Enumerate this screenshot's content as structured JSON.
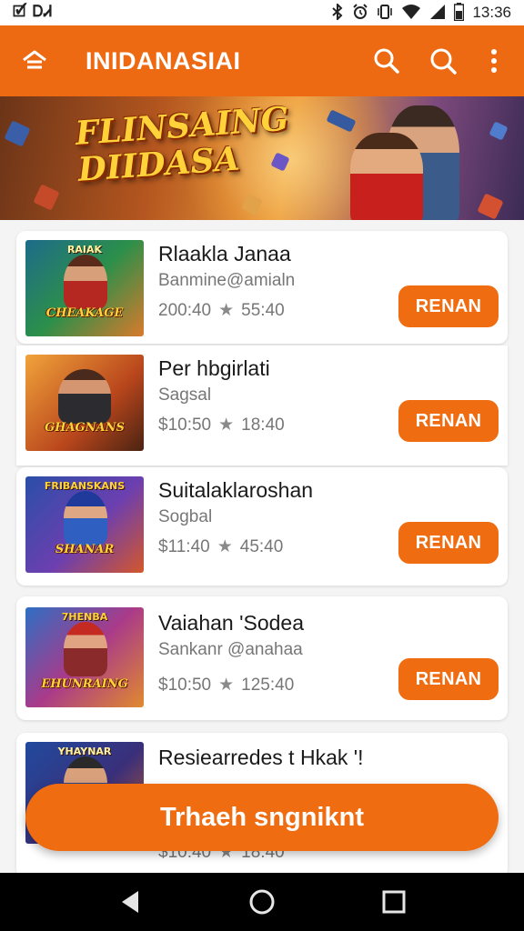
{
  "status_bar": {
    "left_text": "🗹 ᎠᏗ",
    "time": "13:36",
    "icons": [
      "bluetooth-icon",
      "alarm-icon",
      "vibrate-icon",
      "wifi-icon",
      "signal-icon",
      "battery-icon"
    ]
  },
  "app_bar": {
    "title": "INIDANASIAI",
    "home_icon": "home-icon",
    "actions": [
      "search-icon",
      "search-icon",
      "more-vertical-icon"
    ],
    "color": "#ee6a12"
  },
  "banner": {
    "title_line1": "FLINSAING",
    "title_line2": "DIIDASA"
  },
  "items": [
    {
      "title": "Rlaakla Janaa",
      "subtitle": "Banmine@amialn",
      "price": "200:40",
      "rating": "55:40",
      "button": "RENAN",
      "thumb_top": "RAIAK",
      "thumb_label": "CHEAKAGE"
    },
    {
      "title": "Per hbgirlati",
      "subtitle": "Sagsal",
      "price": "$10:50",
      "rating": "18:40",
      "button": "RENAN",
      "thumb_top": "",
      "thumb_label": "GHAGNANS"
    },
    {
      "title": "Suitalaklaroshan",
      "subtitle": "Sogbal",
      "price": "$11:40",
      "rating": "45:40",
      "button": "RENAN",
      "thumb_top": "FRIBANSKANS",
      "thumb_label": "SHANAR"
    },
    {
      "title": "Vaiahan 'Sodea",
      "subtitle": "Sankanr @anahaa",
      "price": "$10:50",
      "rating": "125:40",
      "button": "RENAN",
      "thumb_top": "7HENBA",
      "thumb_label": "EHUNRAING"
    },
    {
      "title": "Resiearredes t Hkak '!",
      "subtitle": "",
      "price": "$10:40",
      "rating": "18:40",
      "button": "",
      "thumb_top": "YHAYNAR",
      "thumb_label": ""
    }
  ],
  "fab": {
    "label": "Trhaeh sngniknt"
  },
  "nav_bar": {
    "icons": [
      "back-icon",
      "home-circle-icon",
      "recents-icon"
    ]
  },
  "colors": {
    "accent": "#ef6c10",
    "background": "#f4f4f4",
    "card": "#ffffff"
  }
}
